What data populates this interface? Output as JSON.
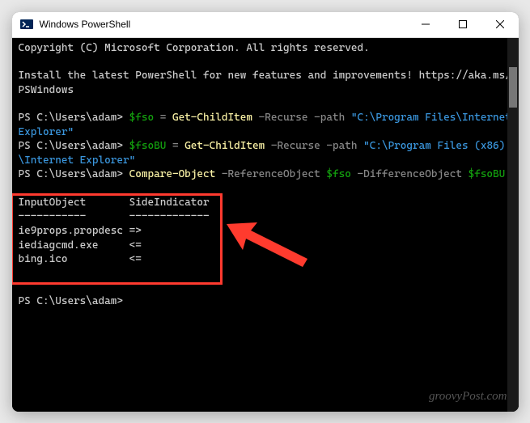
{
  "titlebar": {
    "title": "Windows PowerShell"
  },
  "terminal": {
    "copyright": "Copyright (C) Microsoft Corporation. All rights reserved.",
    "install_msg": "Install the latest PowerShell for new features and improvements! https://aka.ms/PSWindows",
    "prompt": "PS C:\\Users\\adam>",
    "cmd1": {
      "var": "$fso",
      "eq": " = ",
      "cmdlet": "Get-ChildItem",
      "flag1": " -Recurse ",
      "flag2": "-path ",
      "path": "\"C:\\Program Files\\Internet Explorer\""
    },
    "cmd2": {
      "var": "$fsoBU",
      "eq": " = ",
      "cmdlet": "Get-ChildItem",
      "flag1": " -Recurse ",
      "flag2": "-path ",
      "path": "\"C:\\Program Files (x86)\\Internet Explorer\""
    },
    "cmd3": {
      "cmdlet": "Compare-Object",
      "flag1": " -ReferenceObject ",
      "var1": "$fso",
      "flag2": " -DifferenceObject ",
      "var2": "$fsoBU"
    },
    "output": {
      "header": "InputObject       SideIndicator",
      "divider": "-----------       -------------",
      "row1": "ie9props.propdesc =>",
      "row2": "iediagcmd.exe     <=",
      "row3": "bing.ico          <="
    }
  },
  "watermark": "groovyPost.com"
}
